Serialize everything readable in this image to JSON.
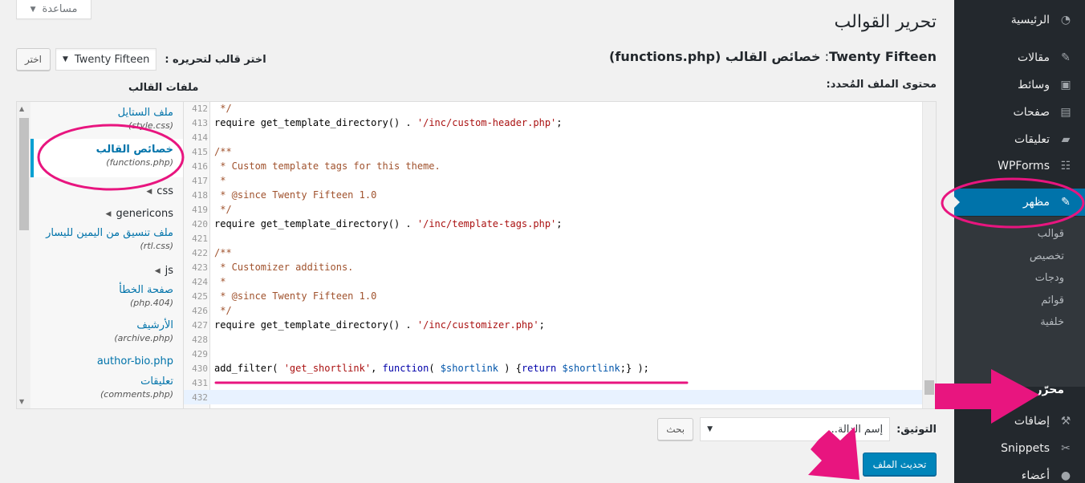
{
  "help_tab": {
    "label": "مساعدة"
  },
  "page_title": "تحرير القوالب",
  "file_heading": {
    "theme": "Twenty Fifteen",
    "colon": ": ",
    "text": "خصائص القالب (functions.php)"
  },
  "theme_select": {
    "label": "اختر قالب لتحريره :",
    "value": "Twenty Fifteen",
    "button": "اختر"
  },
  "content_label": "محتوى الملف المُحدد:",
  "files_label": "ملفات القالب",
  "sidebar": {
    "items": [
      {
        "label": "الرئيسية",
        "icon": "dashboard-icon"
      },
      {
        "label": "مقالات",
        "icon": "pin-icon"
      },
      {
        "label": "وسائط",
        "icon": "media-icon"
      },
      {
        "label": "صفحات",
        "icon": "pages-icon"
      },
      {
        "label": "تعليقات",
        "icon": "comments-icon"
      },
      {
        "label": "WPForms",
        "icon": "forms-icon"
      },
      {
        "label": "مظهر",
        "icon": "appearance-icon"
      },
      {
        "label": "إضافات",
        "icon": "plugins-icon"
      },
      {
        "label": "Snippets",
        "icon": "scissors-icon"
      },
      {
        "label": "أعضاء",
        "icon": "users-icon"
      }
    ],
    "submenu": [
      "قوالب",
      "تخصيص",
      "ودجات",
      "قوائم",
      "خلفية",
      "محرّر"
    ]
  },
  "files": [
    {
      "name": "ملف الستايل",
      "file": "(style.css)"
    },
    {
      "name": "خصائص القالب",
      "file": "(functions.php)"
    },
    {
      "folder": "css"
    },
    {
      "folder": "genericons"
    },
    {
      "name": "ملف تنسيق من اليمين لليسار",
      "file": "(rtl.css)"
    },
    {
      "folder": "js"
    },
    {
      "name": "صفحة الخطأ",
      "file": "(404.php)"
    },
    {
      "name": "الأرشيف",
      "file": "(archive.php)"
    },
    {
      "name": "author-bio.php",
      "file": ""
    },
    {
      "name": "تعليقات",
      "file": "(comments.php)"
    }
  ],
  "code": [
    {
      "n": "412",
      "parts": [
        [
          "c-comment",
          " */"
        ]
      ]
    },
    {
      "n": "413",
      "parts": [
        [
          "c-fn",
          "require get_template_directory() . "
        ],
        [
          "c-str",
          "'/inc/custom-header.php'"
        ],
        [
          "c-fn",
          ";"
        ]
      ]
    },
    {
      "n": "414",
      "parts": []
    },
    {
      "n": "415",
      "parts": [
        [
          "c-comment",
          "/**"
        ]
      ]
    },
    {
      "n": "416",
      "parts": [
        [
          "c-comment",
          " * Custom template tags for this theme."
        ]
      ]
    },
    {
      "n": "417",
      "parts": [
        [
          "c-comment",
          " *"
        ]
      ]
    },
    {
      "n": "418",
      "parts": [
        [
          "c-comment",
          " * @since Twenty Fifteen 1.0"
        ]
      ]
    },
    {
      "n": "419",
      "parts": [
        [
          "c-comment",
          " */"
        ]
      ]
    },
    {
      "n": "420",
      "parts": [
        [
          "c-fn",
          "require get_template_directory() . "
        ],
        [
          "c-str",
          "'/inc/template-tags.php'"
        ],
        [
          "c-fn",
          ";"
        ]
      ]
    },
    {
      "n": "421",
      "parts": []
    },
    {
      "n": "422",
      "parts": [
        [
          "c-comment",
          "/**"
        ]
      ]
    },
    {
      "n": "423",
      "parts": [
        [
          "c-comment",
          " * Customizer additions."
        ]
      ]
    },
    {
      "n": "424",
      "parts": [
        [
          "c-comment",
          " *"
        ]
      ]
    },
    {
      "n": "425",
      "parts": [
        [
          "c-comment",
          " * @since Twenty Fifteen 1.0"
        ]
      ]
    },
    {
      "n": "426",
      "parts": [
        [
          "c-comment",
          " */"
        ]
      ]
    },
    {
      "n": "427",
      "parts": [
        [
          "c-fn",
          "require get_template_directory() . "
        ],
        [
          "c-str",
          "'/inc/customizer.php'"
        ],
        [
          "c-fn",
          ";"
        ]
      ]
    },
    {
      "n": "428",
      "parts": []
    },
    {
      "n": "429",
      "parts": []
    },
    {
      "n": "430",
      "parts": [
        [
          "c-fn",
          "add_filter( "
        ],
        [
          "c-str",
          "'get_shortlink'"
        ],
        [
          "c-fn",
          ", "
        ],
        [
          "c-kw",
          "function"
        ],
        [
          "c-fn",
          "( "
        ],
        [
          "c-var",
          "$shortlink"
        ],
        [
          "c-fn",
          " ) {"
        ],
        [
          "c-kw",
          "return "
        ],
        [
          "c-var",
          "$shortlink"
        ],
        [
          "c-fn",
          ";} );"
        ]
      ]
    },
    {
      "n": "431",
      "parts": []
    },
    {
      "n": "432",
      "parts": []
    }
  ],
  "docs": {
    "label": "التوثيق:",
    "placeholder": "إسم الدالة...",
    "button": "بحث"
  },
  "update_button": "تحديث الملف",
  "colors": {
    "accent": "#0073aa",
    "sidebar": "#23282d",
    "highlight": "#e8157f"
  }
}
